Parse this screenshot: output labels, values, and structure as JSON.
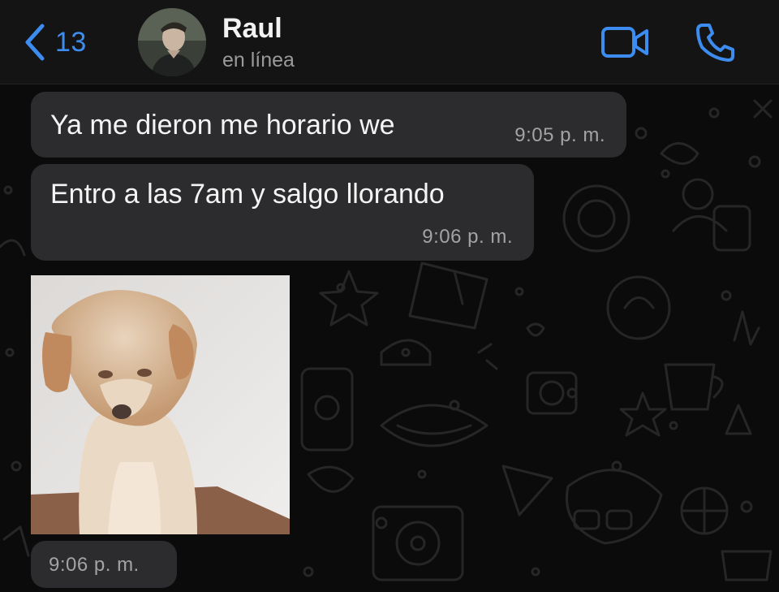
{
  "header": {
    "back_count": "13",
    "contact_name": "Raul",
    "contact_status": "en línea",
    "icons": {
      "back": "chevron-left-icon",
      "video": "video-camera-icon",
      "call": "phone-icon"
    },
    "accent_color": "#3d8cf0"
  },
  "messages": [
    {
      "type": "text",
      "text": "Ya me dieron me horario we",
      "time": "9:05 p. m."
    },
    {
      "type": "text",
      "text": "Entro a las 7am y salgo llorando",
      "time": "9:06 p. m."
    },
    {
      "type": "image",
      "subject": "sad-puppy-image",
      "time": "9:06 p. m."
    }
  ],
  "colors": {
    "bubble_bg": "#2c2c2e",
    "chat_bg": "#0b0b0b",
    "header_bg": "#141414"
  }
}
